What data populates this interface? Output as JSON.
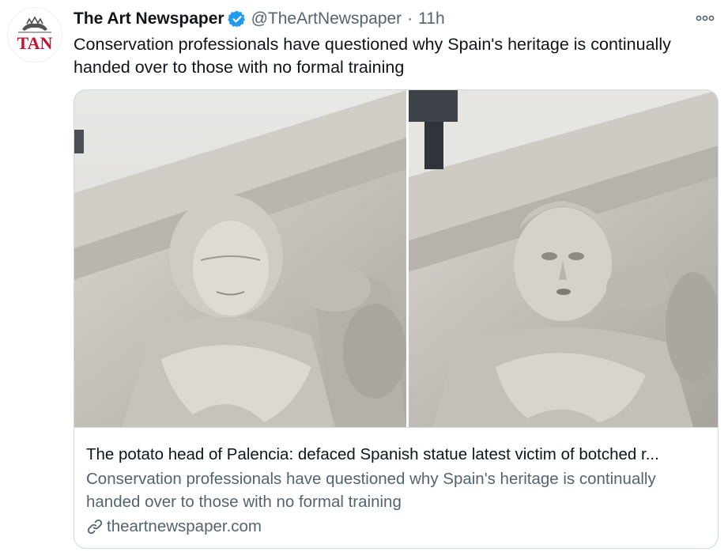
{
  "tweet": {
    "author_name": "The Art Newspaper",
    "handle": "@TheArtNewspaper",
    "separator": "·",
    "time": "11h",
    "avatar_text": "TAN",
    "text": "Conservation professionals have questioned why Spain's heritage is continually handed over to those with no formal training"
  },
  "card": {
    "title": "The potato head of Palencia: defaced Spanish statue latest victim of botched r...",
    "description": "Conservation professionals have questioned why Spain's heritage is continually handed over to those with no formal training",
    "domain": "theartnewspaper.com"
  },
  "icons": {
    "verified": "verified-badge-icon",
    "more": "more-options-icon",
    "link": "link-icon"
  },
  "colors": {
    "verified_blue": "#1d9bf0",
    "avatar_red": "#c8102e",
    "secondary_text": "#536471",
    "border": "#cfd9de"
  }
}
